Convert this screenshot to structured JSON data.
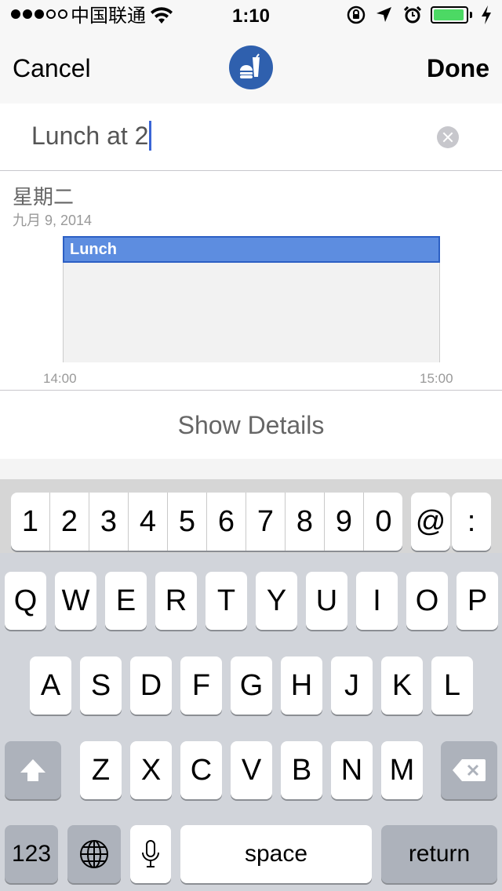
{
  "status_bar": {
    "carrier": "中国联通",
    "time": "1:10",
    "battery_level": 0.95
  },
  "nav": {
    "cancel_label": "Cancel",
    "done_label": "Done",
    "badge_icon": "food-drink-icon",
    "badge_color": "#2f60ae"
  },
  "title_field": {
    "value": "Lunch at 2"
  },
  "day": {
    "name": "星期二",
    "date": "九月 9, 2014",
    "event_label": "Lunch",
    "time_start": "14:00",
    "time_end": "15:00",
    "event_color": "#5d8de0"
  },
  "details": {
    "label": "Show Details"
  },
  "keyboard": {
    "numbers": [
      "1",
      "2",
      "3",
      "4",
      "5",
      "6",
      "7",
      "8",
      "9",
      "0"
    ],
    "at_key": "@",
    "colon_key": ":",
    "row1": [
      "Q",
      "W",
      "E",
      "R",
      "T",
      "Y",
      "U",
      "I",
      "O",
      "P"
    ],
    "row2": [
      "A",
      "S",
      "D",
      "F",
      "G",
      "H",
      "J",
      "K",
      "L"
    ],
    "row3": [
      "Z",
      "X",
      "C",
      "V",
      "B",
      "N",
      "M"
    ],
    "numbers_label": "123",
    "space_label": "space",
    "return_label": "return"
  }
}
